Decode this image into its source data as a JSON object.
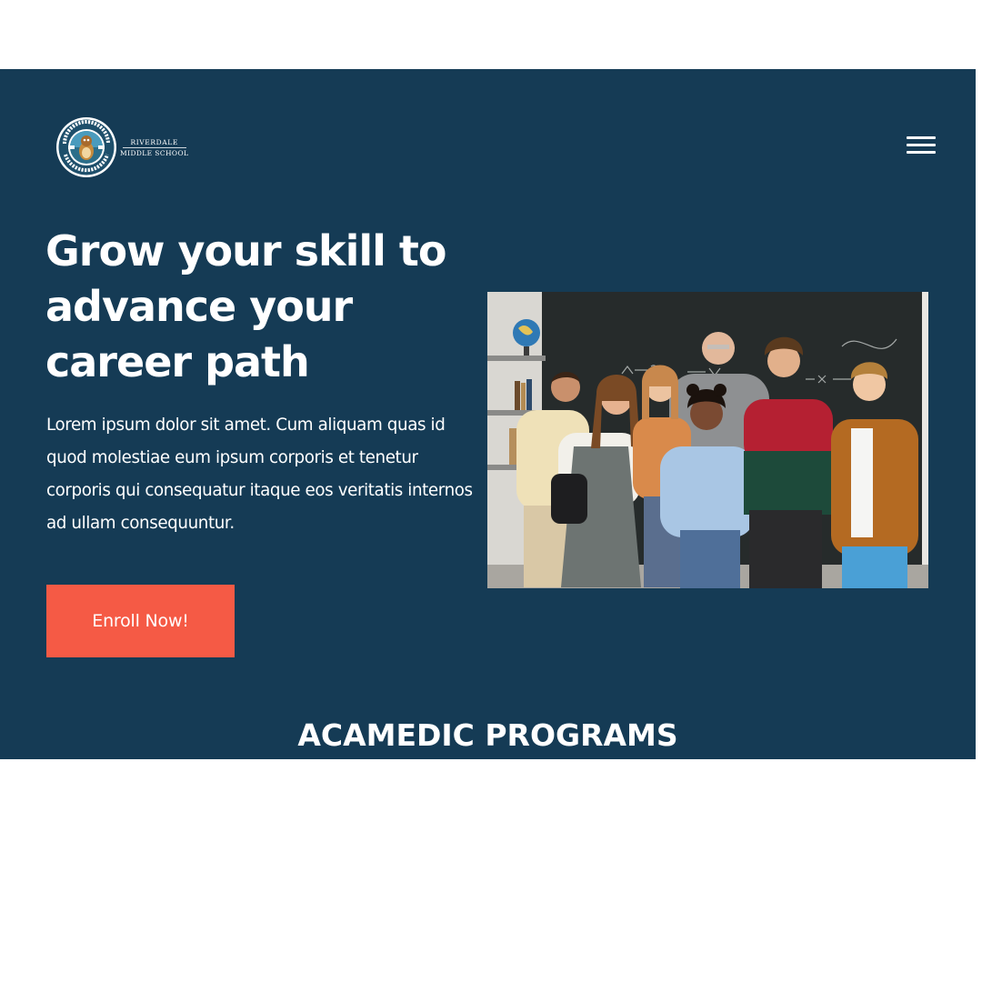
{
  "header": {
    "logo": {
      "seal_text": "RIVERDALE MIDDLE SCHOOL",
      "line1": "RIVERDALE",
      "line2": "MIDDLE SCHOOL"
    },
    "menu_icon": "hamburger-menu-icon"
  },
  "hero": {
    "title_lines": [
      "Grow your skill to",
      "advance your",
      "career path"
    ],
    "description": "Lorem ipsum dolor sit amet. Cum aliquam quas id quod molestiae eum ipsum corporis et tenetur corporis qui consequatur itaque eos veritatis internos ad ullam consequuntur.",
    "cta_label": "Enroll Now!",
    "image": "group-of-students-with-teacher-in-classroom"
  },
  "section": {
    "heading": "ACAMEDIC PROGRAMS"
  },
  "colors": {
    "hero_background": "#153b55",
    "cta_background": "#f55a45",
    "text": "#ffffff",
    "page_background": "#ffffff"
  }
}
